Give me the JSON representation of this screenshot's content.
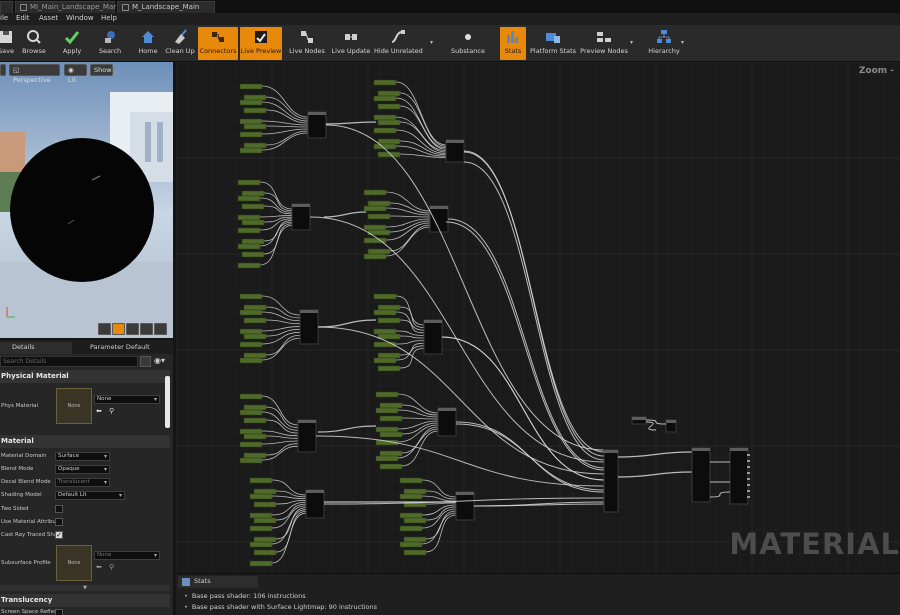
{
  "tabs": [
    {
      "label": "MI_Main_Landscape_Mar"
    },
    {
      "label": "M_Landscape_Main"
    }
  ],
  "menu": [
    "ile",
    "Edit",
    "Asset",
    "Window",
    "Help"
  ],
  "toolbar": [
    {
      "label": "Save",
      "icon": "save-icon",
      "active": false
    },
    {
      "label": "Browse",
      "icon": "browse-icon",
      "active": false
    },
    {
      "label": "Apply",
      "icon": "apply-checkmark-icon",
      "active": false
    },
    {
      "label": "Search",
      "icon": "search-icon",
      "active": false
    },
    {
      "label": "Home",
      "icon": "home-icon",
      "active": false
    },
    {
      "label": "Clean Up",
      "icon": "clean-up-icon",
      "active": false
    },
    {
      "label": "Connectors",
      "icon": "connectors-icon",
      "active": true
    },
    {
      "label": "Live Preview",
      "icon": "live-preview-icon",
      "active": true
    },
    {
      "label": "Live Nodes",
      "icon": "live-nodes-icon",
      "active": false
    },
    {
      "label": "Live Update",
      "icon": "live-update-icon",
      "active": false
    },
    {
      "label": "Hide Unrelated",
      "icon": "hide-unrelated-icon",
      "active": false
    },
    {
      "label": "Substance",
      "icon": "substance-icon",
      "active": false
    },
    {
      "label": "Stats",
      "icon": "stats-icon",
      "active": true
    },
    {
      "label": "Platform Stats",
      "icon": "platform-stats-icon",
      "active": false
    },
    {
      "label": "Preview Nodes",
      "icon": "preview-nodes-icon",
      "active": false
    },
    {
      "label": "Hierarchy",
      "icon": "hierarchy-icon",
      "active": false
    }
  ],
  "viewport": {
    "perspective_label": "Perspective",
    "lit_label": "Lit",
    "show_label": "Show"
  },
  "details": {
    "tab_details": "Details",
    "tab_params": "Parameter Default",
    "search_placeholder": "Search Details",
    "physical_material_section": "Physical Material",
    "phys_material_label": "Phys Material",
    "phys_material_thumb": "None",
    "phys_material_value": "None",
    "material_section": "Material",
    "rows": [
      {
        "label": "Material Domain",
        "value": "Surface",
        "type": "combo"
      },
      {
        "label": "Blend Mode",
        "value": "Opaque",
        "type": "combo"
      },
      {
        "label": "Decal Blend Mode",
        "value": "Translucent",
        "type": "combo-dim"
      },
      {
        "label": "Shading Model",
        "value": "Default Lit",
        "type": "combo"
      },
      {
        "label": "Two Sided",
        "value": "",
        "type": "check"
      },
      {
        "label": "Use Material Attribut",
        "value": "",
        "type": "check"
      },
      {
        "label": "Cast Ray Traced Sha",
        "value": "",
        "type": "check-on"
      }
    ],
    "subsurface_label": "Subsurface Profile",
    "subsurface_thumb": "None",
    "subsurface_value": "None",
    "translucency_section": "Translucency",
    "screen_space_label": "Screen Space Reflec"
  },
  "graph": {
    "zoom_label": "Zoom -",
    "watermark": "MATERIAL"
  },
  "stats": {
    "tab_label": "Stats",
    "lines": [
      "Base pass shader: 106 instructions",
      "Base pass shader with Surface Lightmap: 90 instructions"
    ]
  },
  "colors": {
    "accent": "#e8890c",
    "node_green": "#4f6b2a",
    "wire": "#d8d8d8"
  }
}
